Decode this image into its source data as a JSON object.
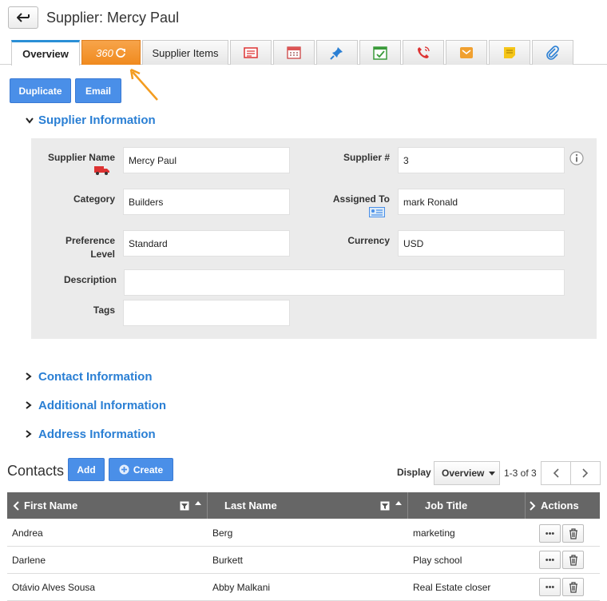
{
  "header": {
    "title": "Supplier: Mercy Paul"
  },
  "tabs": {
    "overview": "Overview",
    "t360": "360",
    "supplier_items": "Supplier Items"
  },
  "actions": {
    "duplicate": "Duplicate",
    "email": "Email"
  },
  "sections": {
    "supplier_info": "Supplier Information",
    "contact_info": "Contact Information",
    "additional_info": "Additional Information",
    "address_info": "Address Information"
  },
  "fields": {
    "supplier_name_label": "Supplier Name",
    "supplier_name": "Mercy Paul",
    "supplier_no_label": "Supplier #",
    "supplier_no": "3",
    "category_label": "Category",
    "category": "Builders",
    "assigned_to_label": "Assigned To",
    "assigned_to": "mark Ronald",
    "preference_label_1": "Preference",
    "preference_label_2": "Level",
    "preference": "Standard",
    "currency_label": "Currency",
    "currency": "USD",
    "description_label": "Description",
    "description": "",
    "tags_label": "Tags",
    "tags": ""
  },
  "contacts": {
    "title": "Contacts",
    "add": "Add",
    "create": "Create",
    "display_label": "Display",
    "display_value": "Overview",
    "range": "1-3 of 3",
    "columns": {
      "first": "First Name",
      "last": "Last Name",
      "job": "Job Title",
      "actions": "Actions"
    },
    "rows": [
      {
        "first": "Andrea",
        "last": "Berg",
        "job": "marketing"
      },
      {
        "first": "Darlene",
        "last": "Burkett",
        "job": "Play school"
      },
      {
        "first": "Otávio Alves Sousa",
        "last": "Abby Malkani",
        "job": "Real Estate closer"
      }
    ]
  },
  "colors": {
    "accent": "#4a8fe8",
    "tab360": "#f08a1e",
    "link": "#2a7fd4"
  }
}
